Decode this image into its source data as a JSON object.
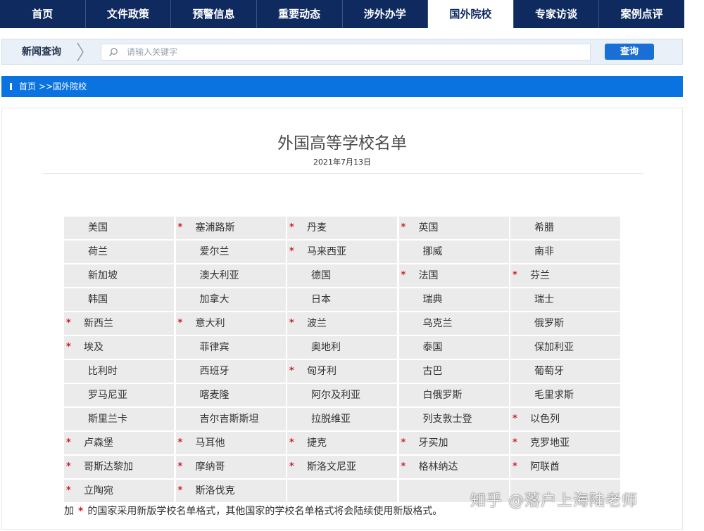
{
  "nav": {
    "tabs": [
      {
        "label": "首页",
        "active": false
      },
      {
        "label": "文件政策",
        "active": false
      },
      {
        "label": "预警信息",
        "active": false
      },
      {
        "label": "重要动态",
        "active": false
      },
      {
        "label": "涉外办学",
        "active": false
      },
      {
        "label": "国外院校",
        "active": true
      },
      {
        "label": "专家访谈",
        "active": false
      },
      {
        "label": "案例点评",
        "active": false
      }
    ]
  },
  "search": {
    "label": "新闻查询",
    "placeholder": "请输入关键字",
    "value": "",
    "button": "查询"
  },
  "breadcrumb": {
    "home": "首页",
    "current": ">>国外院校"
  },
  "article": {
    "title": "外国高等学校名单",
    "date": "2021年7月13日"
  },
  "countries": [
    {
      "name": "美国",
      "starred": false
    },
    {
      "name": "塞浦路斯",
      "starred": true
    },
    {
      "name": "丹麦",
      "starred": true
    },
    {
      "name": "英国",
      "starred": true
    },
    {
      "name": "希腊",
      "starred": false
    },
    {
      "name": "荷兰",
      "starred": false
    },
    {
      "name": "爱尔兰",
      "starred": false
    },
    {
      "name": "马来西亚",
      "starred": true
    },
    {
      "name": "挪威",
      "starred": false
    },
    {
      "name": "南非",
      "starred": false
    },
    {
      "name": "新加坡",
      "starred": false
    },
    {
      "name": "澳大利亚",
      "starred": false
    },
    {
      "name": "德国",
      "starred": false
    },
    {
      "name": "法国",
      "starred": true
    },
    {
      "name": "芬兰",
      "starred": true
    },
    {
      "name": "韩国",
      "starred": false
    },
    {
      "name": "加拿大",
      "starred": false
    },
    {
      "name": "日本",
      "starred": false
    },
    {
      "name": "瑞典",
      "starred": false
    },
    {
      "name": "瑞士",
      "starred": false
    },
    {
      "name": "新西兰",
      "starred": true
    },
    {
      "name": "意大利",
      "starred": true
    },
    {
      "name": "波兰",
      "starred": true
    },
    {
      "name": "乌克兰",
      "starred": false
    },
    {
      "name": "俄罗斯",
      "starred": false
    },
    {
      "name": "埃及",
      "starred": true
    },
    {
      "name": "菲律宾",
      "starred": false
    },
    {
      "name": "奥地利",
      "starred": false
    },
    {
      "name": "泰国",
      "starred": false
    },
    {
      "name": "保加利亚",
      "starred": false
    },
    {
      "name": "比利时",
      "starred": false
    },
    {
      "name": "西班牙",
      "starred": false
    },
    {
      "name": "匈牙利",
      "starred": true
    },
    {
      "name": "古巴",
      "starred": false
    },
    {
      "name": "葡萄牙",
      "starred": false
    },
    {
      "name": "罗马尼亚",
      "starred": false
    },
    {
      "name": "喀麦隆",
      "starred": false
    },
    {
      "name": "阿尔及利亚",
      "starred": false
    },
    {
      "name": "白俄罗斯",
      "starred": false
    },
    {
      "name": "毛里求斯",
      "starred": false
    },
    {
      "name": "斯里兰卡",
      "starred": false
    },
    {
      "name": "吉尔吉斯斯坦",
      "starred": false
    },
    {
      "name": "拉脱维亚",
      "starred": false
    },
    {
      "name": "列支敦士登",
      "starred": false
    },
    {
      "name": "以色列",
      "starred": true
    },
    {
      "name": "卢森堡",
      "starred": true
    },
    {
      "name": "马耳他",
      "starred": true
    },
    {
      "name": "捷克",
      "starred": true
    },
    {
      "name": "牙买加",
      "starred": true
    },
    {
      "name": "克罗地亚",
      "starred": true
    },
    {
      "name": "哥斯达黎加",
      "starred": true
    },
    {
      "name": "摩纳哥",
      "starred": true
    },
    {
      "name": "斯洛文尼亚",
      "starred": true
    },
    {
      "name": "格林纳达",
      "starred": true
    },
    {
      "name": "阿联酋",
      "starred": true
    },
    {
      "name": "立陶宛",
      "starred": true
    },
    {
      "name": "斯洛伐克",
      "starred": true
    },
    {
      "name": "",
      "starred": false
    },
    {
      "name": "",
      "starred": false
    },
    {
      "name": "",
      "starred": false
    }
  ],
  "note": {
    "prefix": "加",
    "star": "*",
    "text": "的国家采用新版学校名单格式，其他国家的学校名单格式将会陆续使用新版格式。"
  },
  "watermark": "知乎 @落户上海陆老师",
  "colors": {
    "nav_bg": "#0e2a5e",
    "crumb_bg": "#0a73e0",
    "button_bg": "#1a6fd6",
    "star": "#d11b2c",
    "cell_bg": "#ebebeb"
  }
}
